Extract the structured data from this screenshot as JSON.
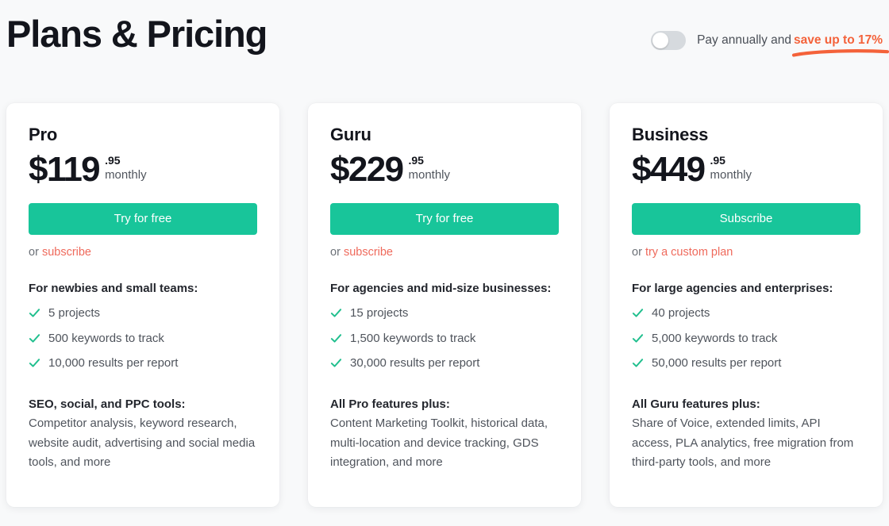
{
  "header": {
    "title": "Plans & Pricing",
    "toggle": {
      "state": "off",
      "label": "Pay annually and",
      "highlight": "save up to 17%",
      "highlight_color": "#f4623a"
    }
  },
  "plans": [
    {
      "name": "Pro",
      "price": "$119",
      "cents": ".95",
      "period": "monthly",
      "cta": "Try for free",
      "sub_prefix": "or",
      "sub_link": "subscribe",
      "audience": "For newbies and small teams:",
      "features": [
        "5 projects",
        "500 keywords to track",
        "10,000 results per report"
      ],
      "extras_title": "SEO, social, and PPC tools:",
      "extras_body": "Competitor analysis, keyword research, website audit, advertising and social media tools, and more"
    },
    {
      "name": "Guru",
      "price": "$229",
      "cents": ".95",
      "period": "monthly",
      "cta": "Try for free",
      "sub_prefix": "or",
      "sub_link": "subscribe",
      "audience": "For agencies and mid-size businesses:",
      "features": [
        "15 projects",
        "1,500 keywords to track",
        "30,000 results per report"
      ],
      "extras_title": "All Pro features plus:",
      "extras_body": "Content Marketing Toolkit, historical data, multi-location and device tracking, GDS integration, and more"
    },
    {
      "name": "Business",
      "price": "$449",
      "cents": ".95",
      "period": "monthly",
      "cta": "Subscribe",
      "sub_prefix": "or",
      "sub_link": "try a custom plan",
      "audience": "For large agencies and enterprises:",
      "features": [
        "40 projects",
        "5,000 keywords to track",
        "50,000 results per report"
      ],
      "extras_title": "All Guru features plus:",
      "extras_body": "Share of Voice, extended limits, API access, PLA analytics, free migration from third-party tools, and more"
    }
  ],
  "theme": {
    "accent_green": "#18c59a",
    "link_coral": "#ef6a5c",
    "accent_orange": "#f4623a",
    "check_green": "#21bf8e",
    "page_bg": "#f8f9fa",
    "card_bg": "#ffffff"
  },
  "icons": {
    "check": "check-icon",
    "toggle": "toggle-switch-icon",
    "underline": "underline-stroke-icon"
  }
}
